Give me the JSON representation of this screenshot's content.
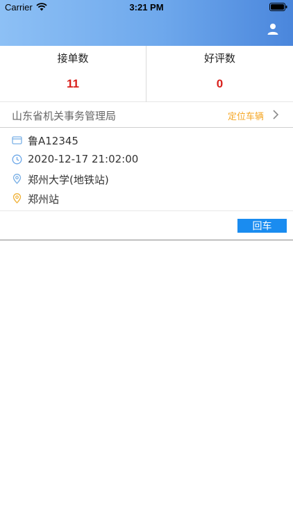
{
  "status_bar": {
    "carrier": "Carrier",
    "time": "3:21 PM"
  },
  "header": {
    "user_icon": "user-icon"
  },
  "stats": {
    "orders_label": "接单数",
    "orders_value": "11",
    "reviews_label": "好评数",
    "reviews_value": "0"
  },
  "org": {
    "name": "山东省机关事务管理局",
    "locate_label": "定位车辆"
  },
  "details": {
    "plate": "鲁A12345",
    "datetime": "2020-12-17 21:02:00",
    "origin": "郑州大学(地铁站)",
    "destination": "郑州站"
  },
  "actions": {
    "return_label": "回车"
  },
  "colors": {
    "accent": "#1a8cf0",
    "value_red": "#d9201c",
    "link_orange": "#f5a623"
  }
}
